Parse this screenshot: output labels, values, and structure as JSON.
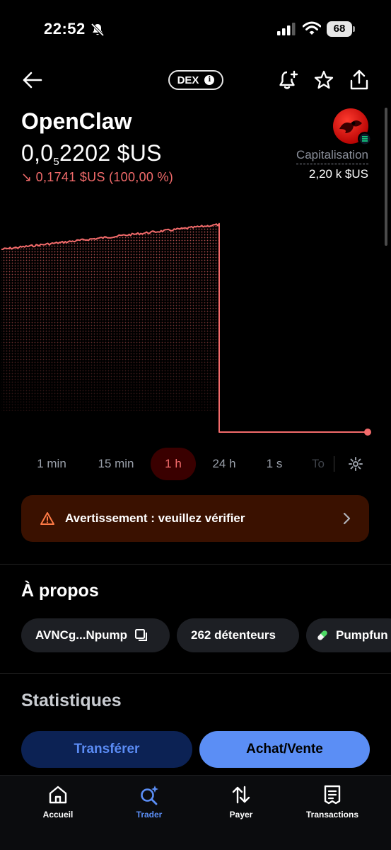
{
  "status_bar": {
    "time": "22:52",
    "battery": "68"
  },
  "header": {
    "badge": "DEX",
    "name": "OpenClaw",
    "price_prefix": "0,0",
    "price_subscript": "5",
    "price_suffix": "2202 $US",
    "change": "↘ 0,1741 $US (100,00 %)",
    "market_cap_label": "Capitalisation",
    "market_cap_value": "2,20 k $US"
  },
  "chart_data": {
    "type": "line",
    "trend": "steady rise then collapse to near zero",
    "line_color": "#f36b6b"
  },
  "time_ranges": [
    {
      "label": "1 min"
    },
    {
      "label": "15 min"
    },
    {
      "label": "1 h",
      "active": true
    },
    {
      "label": "24 h"
    },
    {
      "label": "1 s"
    },
    {
      "label": "To"
    }
  ],
  "warning": {
    "text": "Avertissement : veuillez vérifier"
  },
  "about": {
    "title": "À propos",
    "chips": [
      {
        "label": "AVNCg...Npump",
        "icon": "copy-icon"
      },
      {
        "label": "262 détenteurs"
      },
      {
        "label": "Pumpfun",
        "icon": "pill-icon"
      }
    ]
  },
  "stats": {
    "title": "Statistiques"
  },
  "actions": {
    "transfer": "Transférer",
    "trade": "Achat/Vente"
  },
  "tabs": [
    {
      "label": "Accueil",
      "icon": "home-icon"
    },
    {
      "label": "Trader",
      "icon": "search-sparkle-icon",
      "active": true
    },
    {
      "label": "Payer",
      "icon": "transfer-arrows-icon"
    },
    {
      "label": "Transactions",
      "icon": "receipt-icon"
    }
  ],
  "colors": {
    "accent": "#5b8ef5",
    "negative": "#f36b6b",
    "warning_bg": "#3a1100"
  }
}
